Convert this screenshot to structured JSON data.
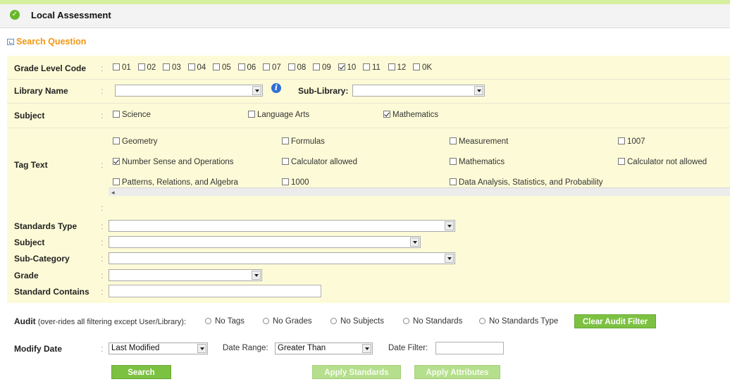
{
  "header": {
    "title": "Local Assessment"
  },
  "search_question": {
    "label": "Search Question"
  },
  "grade_level": {
    "label": "Grade Level Code",
    "options": [
      {
        "label": "01",
        "checked": false
      },
      {
        "label": "02",
        "checked": false
      },
      {
        "label": "03",
        "checked": false
      },
      {
        "label": "04",
        "checked": false
      },
      {
        "label": "05",
        "checked": false
      },
      {
        "label": "06",
        "checked": false
      },
      {
        "label": "07",
        "checked": false
      },
      {
        "label": "08",
        "checked": false
      },
      {
        "label": "09",
        "checked": false
      },
      {
        "label": "10",
        "checked": true
      },
      {
        "label": "11",
        "checked": false
      },
      {
        "label": "12",
        "checked": false
      },
      {
        "label": "0K",
        "checked": false
      }
    ]
  },
  "library": {
    "label": "Library Name",
    "value": "",
    "sub_library_label": "Sub-Library:",
    "sub_library_value": ""
  },
  "subject": {
    "label": "Subject",
    "options": [
      {
        "label": "Science",
        "checked": false
      },
      {
        "label": "Language Arts",
        "checked": false
      },
      {
        "label": "Mathematics",
        "checked": true
      }
    ]
  },
  "tag_text": {
    "label": "Tag Text",
    "options": [
      {
        "label": "Geometry",
        "checked": false
      },
      {
        "label": "Formulas",
        "checked": false
      },
      {
        "label": "Measurement",
        "checked": false
      },
      {
        "label": "1007",
        "checked": false
      },
      {
        "label": "Number Sense and Operations",
        "checked": true
      },
      {
        "label": "Calculator allowed",
        "checked": false
      },
      {
        "label": "Mathematics",
        "checked": false
      },
      {
        "label": "Calculator not allowed",
        "checked": false
      },
      {
        "label": "Patterns, Relations, and Algebra",
        "checked": false
      },
      {
        "label": "1000",
        "checked": false
      },
      {
        "label": "Data Analysis, Statistics, and Probability",
        "checked": false
      }
    ]
  },
  "standards": {
    "type_label": "Standards Type",
    "subject_label": "Subject",
    "subcategory_label": "Sub-Category",
    "grade_label": "Grade",
    "contains_label": "Standard Contains"
  },
  "audit": {
    "label": "Audit",
    "note": "(over-rides all filtering except User/Library):",
    "options": [
      "No Tags",
      "No Grades",
      "No Subjects",
      "No Standards",
      "No Standards Type"
    ],
    "clear_button": "Clear Audit Filter"
  },
  "modify_date": {
    "label": "Modify Date",
    "value": "Last Modified",
    "range_label": "Date Range:",
    "range_value": "Greater Than",
    "filter_label": "Date Filter:"
  },
  "buttons": {
    "search": "Search",
    "apply_standards": "Apply Standards",
    "apply_attributes": "Apply Attributes"
  },
  "colors": {
    "accent": "#7dc142",
    "panel": "#fdfbd7",
    "section_title": "#f0960f"
  }
}
